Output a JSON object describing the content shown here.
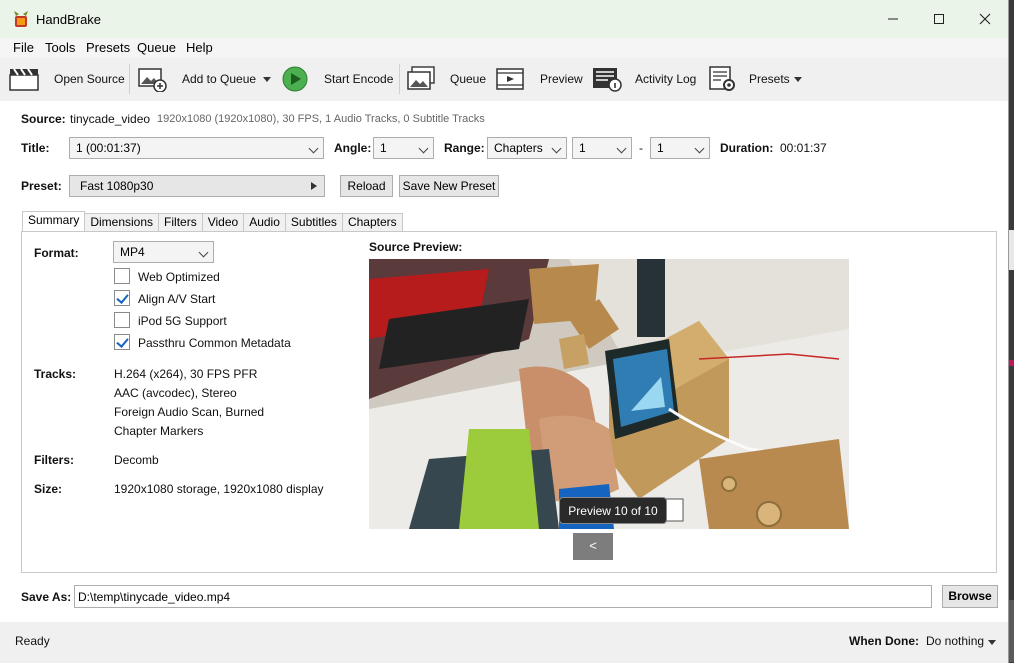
{
  "window": {
    "title": "HandBrake"
  },
  "menu": [
    "File",
    "Tools",
    "Presets",
    "Queue",
    "Help"
  ],
  "toolbar": {
    "open_source": "Open Source",
    "add_to_queue": "Add to Queue",
    "start_encode": "Start Encode",
    "queue": "Queue",
    "preview": "Preview",
    "activity_log": "Activity Log",
    "presets": "Presets"
  },
  "source": {
    "label": "Source:",
    "name": "tinycade_video",
    "info": "1920x1080 (1920x1080), 30 FPS, 1 Audio Tracks, 0 Subtitle Tracks"
  },
  "title_row": {
    "title_label": "Title:",
    "title_value": "1 (00:01:37)",
    "angle_label": "Angle:",
    "angle_value": "1",
    "range_label": "Range:",
    "range_mode": "Chapters",
    "range_start": "1",
    "range_dash": "-",
    "range_end": "1",
    "duration_label": "Duration:",
    "duration_value": "00:01:37"
  },
  "preset": {
    "label": "Preset:",
    "value": "Fast 1080p30",
    "reload": "Reload",
    "save_new": "Save New Preset"
  },
  "tabs": [
    "Summary",
    "Dimensions",
    "Filters",
    "Video",
    "Audio",
    "Subtitles",
    "Chapters"
  ],
  "summary": {
    "format_label": "Format:",
    "format_value": "MP4",
    "options": [
      {
        "label": "Web Optimized",
        "checked": false
      },
      {
        "label": "Align A/V Start",
        "checked": true
      },
      {
        "label": "iPod 5G Support",
        "checked": false
      },
      {
        "label": "Passthru Common Metadata",
        "checked": true
      }
    ],
    "tracks_label": "Tracks:",
    "tracks": [
      "H.264 (x264), 30 FPS PFR",
      "AAC (avcodec), Stereo",
      "Foreign Audio Scan, Burned",
      "Chapter Markers"
    ],
    "filters_label": "Filters:",
    "filters_value": "Decomb",
    "size_label": "Size:",
    "size_value": "1920x1080 storage, 1920x1080 display",
    "preview_label": "Source Preview:",
    "preview_badge": "Preview 10 of 10",
    "preview_prev": "<"
  },
  "save_as": {
    "label": "Save As:",
    "value": "D:\\temp\\tinycade_video.mp4",
    "browse": "Browse"
  },
  "status": {
    "text": "Ready",
    "when_done_label": "When Done:",
    "when_done_value": "Do nothing"
  },
  "colors": {
    "title_bar": "#eaf4e9",
    "accent_check": "#1565c0",
    "start_green": "#4caf50"
  }
}
